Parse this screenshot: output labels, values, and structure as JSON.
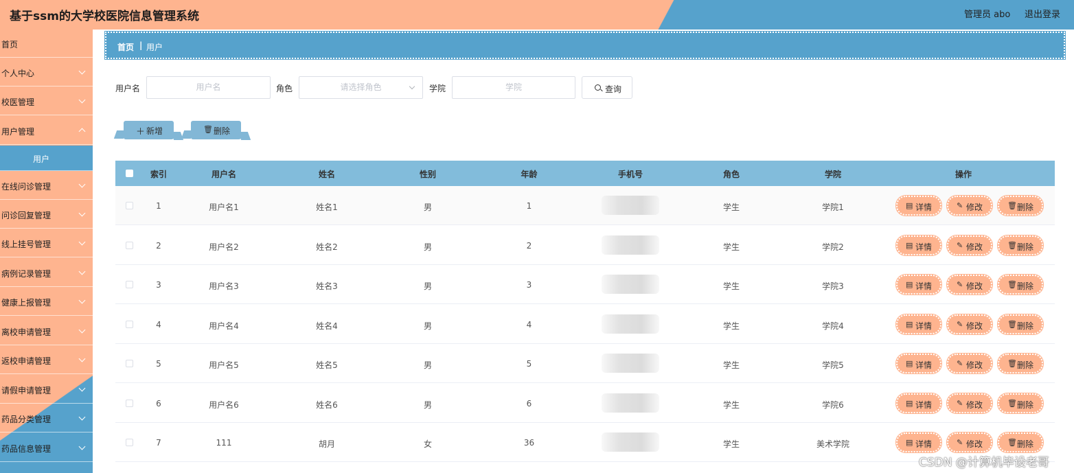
{
  "header": {
    "title": "基于ssm的大学校医院信息管理系统",
    "user": "管理员 abo",
    "logout": "退出登录"
  },
  "sidebar": {
    "items": [
      {
        "label": "首页",
        "has_arrow": false
      },
      {
        "label": "个人中心",
        "has_arrow": true
      },
      {
        "label": "校医管理",
        "has_arrow": true
      },
      {
        "label": "用户管理",
        "has_arrow": true
      },
      {
        "label": "用户",
        "sub": true,
        "active": true
      },
      {
        "label": "在线问诊管理",
        "has_arrow": true
      },
      {
        "label": "问诊回复管理",
        "has_arrow": true
      },
      {
        "label": "线上挂号管理",
        "has_arrow": true
      },
      {
        "label": "病例记录管理",
        "has_arrow": true
      },
      {
        "label": "健康上报管理",
        "has_arrow": true
      },
      {
        "label": "离校申请管理",
        "has_arrow": true
      },
      {
        "label": "返校申请管理",
        "has_arrow": true
      },
      {
        "label": "请假申请管理",
        "has_arrow": true
      },
      {
        "label": "药品分类管理",
        "has_arrow": true
      },
      {
        "label": "药品信息管理",
        "has_arrow": true
      }
    ]
  },
  "breadcrumb": {
    "home": "首页",
    "separator": "|",
    "current": "用户"
  },
  "search": {
    "username_label": "用户名",
    "username_placeholder": "用户名",
    "role_label": "角色",
    "role_placeholder": "请选择角色",
    "college_label": "学院",
    "college_placeholder": "学院",
    "query_label": "查询"
  },
  "actions": {
    "add_icon": "＋",
    "add_label": "新增",
    "delete_icon": "🗑",
    "delete_label": "删除"
  },
  "table": {
    "headers": [
      "索引",
      "用户名",
      "姓名",
      "性别",
      "年龄",
      "手机号",
      "角色",
      "学院",
      "操作"
    ],
    "rows": [
      {
        "index": "1",
        "username": "用户名1",
        "name": "姓名1",
        "gender": "男",
        "age": "1",
        "role": "学生",
        "college": "学院1"
      },
      {
        "index": "2",
        "username": "用户名2",
        "name": "姓名2",
        "gender": "男",
        "age": "2",
        "role": "学生",
        "college": "学院2"
      },
      {
        "index": "3",
        "username": "用户名3",
        "name": "姓名3",
        "gender": "男",
        "age": "3",
        "role": "学生",
        "college": "学院3"
      },
      {
        "index": "4",
        "username": "用户名4",
        "name": "姓名4",
        "gender": "男",
        "age": "4",
        "role": "学生",
        "college": "学院4"
      },
      {
        "index": "5",
        "username": "用户名5",
        "name": "姓名5",
        "gender": "男",
        "age": "5",
        "role": "学生",
        "college": "学院5"
      },
      {
        "index": "6",
        "username": "用户名6",
        "name": "姓名6",
        "gender": "男",
        "age": "6",
        "role": "学生",
        "college": "学院6"
      },
      {
        "index": "7",
        "username": "111",
        "name": "胡月",
        "gender": "女",
        "age": "36",
        "role": "学生",
        "college": "美术学院"
      }
    ],
    "ops": {
      "detail": "详情",
      "detail_icon": "▤",
      "edit": "修改",
      "edit_icon": "✎",
      "delete": "删除",
      "delete_icon": "🗑"
    }
  },
  "watermark": "CSDN @计算机毕设老哥",
  "colors": {
    "orange": "#feb48f",
    "blue": "#56a2cc",
    "table_header": "#82bcdb"
  }
}
